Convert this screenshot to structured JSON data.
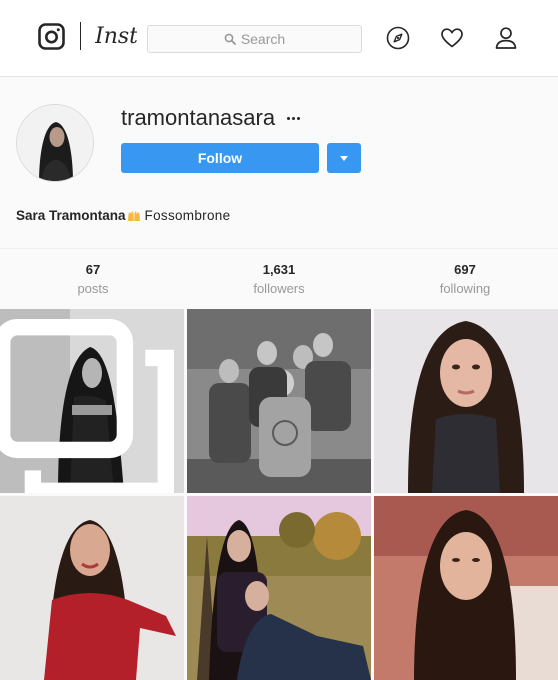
{
  "header": {
    "wordmark": "Instagram",
    "search_placeholder": "Search",
    "icons": [
      "instagram-logo-icon",
      "search-icon",
      "compass-icon",
      "heart-icon",
      "profile-icon"
    ]
  },
  "profile": {
    "username": "tramontanasara",
    "follow_label": "Follow",
    "full_name": "Sara Tramontana",
    "location": "Fossombrone",
    "accent_color": "#3897f0"
  },
  "stats": [
    {
      "value": "67",
      "label": "posts"
    },
    {
      "value": "1,631",
      "label": "followers"
    },
    {
      "value": "697",
      "label": "following"
    }
  ],
  "posts": [
    {
      "subject": "black-and-white portrait, black off-shoulder dress",
      "multiple": true
    },
    {
      "subject": "black-and-white group photo of five girls",
      "multiple": false
    },
    {
      "subject": "close-up selfie, long dark hair, dark jacket",
      "multiple": false
    },
    {
      "subject": "smiling girl in red top",
      "multiple": false
    },
    {
      "subject": "two girls sitting in an autumn park",
      "multiple": false
    },
    {
      "subject": "close-up portrait in warm light",
      "multiple": false
    }
  ]
}
